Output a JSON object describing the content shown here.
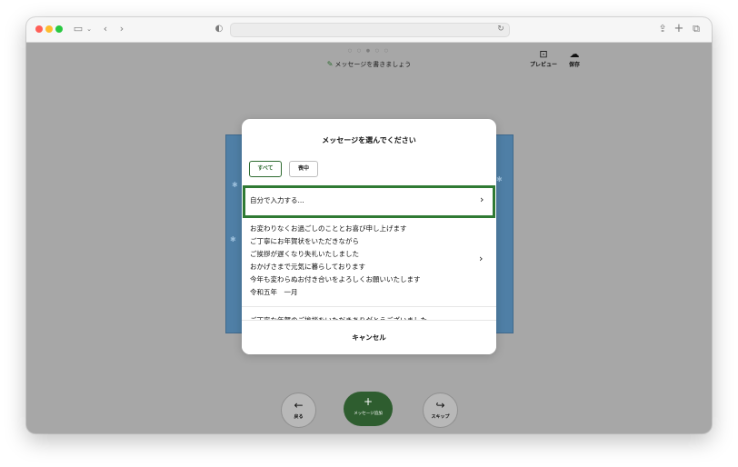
{
  "progress": {
    "dots": "○ ○ ● ○ ○"
  },
  "header": {
    "hint": "メッセージを書きましょう",
    "preview_label": "プレビュー",
    "save_label": "保存"
  },
  "modal": {
    "title": "メッセージを選んでください",
    "filters": [
      {
        "label": "すべて",
        "selected": true
      },
      {
        "label": "喪中",
        "selected": false
      }
    ],
    "custom_option": "自分で入力する...",
    "message_lines": [
      "お変わりなくお過ごしのこととお喜び申し上げます",
      "ご丁寧にお年賀状をいただきながら",
      "ご挨拶が遅くなり失礼いたしました",
      "おかげさまで元気に暮らしております",
      "今年も変わらぬお付き合いをよろしくお願いいたします",
      "令和五年　一月"
    ],
    "next_message_peek": "ご丁寧な年賀のご挨拶をいただきありがとうございました",
    "cancel_label": "キャンセル"
  },
  "bottom_nav": {
    "back_label": "戻る",
    "add_label": "メッセージ追加",
    "skip_label": "スキップ"
  },
  "colors": {
    "accent": "#2e6b30",
    "add_button": "#2e5d2f",
    "card": "#4f7fa6",
    "backdrop": "#a7a7a7"
  }
}
